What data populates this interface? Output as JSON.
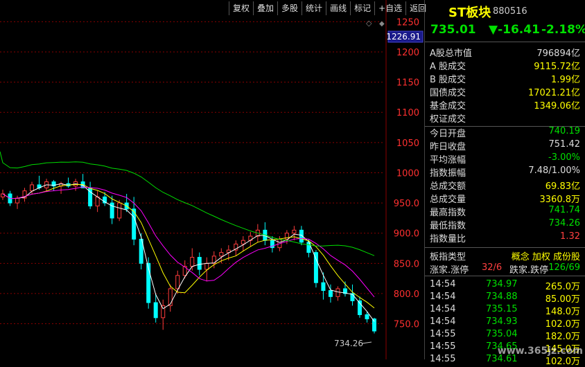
{
  "toolbar": [
    "复权",
    "叠加",
    "多股",
    "统计",
    "画线",
    "标记",
    "+自选",
    "返回"
  ],
  "header": {
    "name": "ST板块",
    "code": "880516",
    "price": "735.01",
    "change": "▼-16.41",
    "pct": "-2.18%"
  },
  "stats": [
    {
      "label": "A股总市值",
      "value": "796894亿",
      "color": "#dddddd"
    },
    {
      "label": "A 股成交",
      "value": "9115.72亿",
      "color": "#ffff00"
    },
    {
      "label": "B 股成交",
      "value": "1.99亿",
      "color": "#ffff00"
    },
    {
      "label": "国债成交",
      "value": "17021.21亿",
      "color": "#ffff00"
    },
    {
      "label": "基金成交",
      "value": "1349.06亿",
      "color": "#ffff00"
    },
    {
      "label": "权证成交",
      "value": "",
      "color": "#ffff00"
    },
    {
      "label": "今日开盘",
      "value": "740.19",
      "color": "#00e000"
    },
    {
      "label": "昨日收盘",
      "value": "751.42",
      "color": "#dddddd"
    },
    {
      "label": "平均涨幅",
      "value": "-3.00%",
      "color": "#00e000"
    },
    {
      "label": "指数振幅",
      "value": "7.48/1.00%",
      "color": "#dddddd"
    },
    {
      "label": "总成交额",
      "value": "69.83亿",
      "color": "#ffff00"
    },
    {
      "label": "总成交量",
      "value": "3360.8万",
      "color": "#ffff00"
    },
    {
      "label": "最高指数",
      "value": "741.74",
      "color": "#00e000"
    },
    {
      "label": "最低指数",
      "value": "734.26",
      "color": "#00e000"
    },
    {
      "label": "指数量比",
      "value": "1.32",
      "color": "#ff4040"
    }
  ],
  "board": {
    "label": "板指类型",
    "tags": "概念 加权 成份股"
  },
  "breadth": {
    "a_label": "涨家.涨停",
    "a_val": "32/6",
    "b_label": "跌家.跌停",
    "b_val": "126/69"
  },
  "ticks": [
    [
      "14:54",
      "734.97",
      "265.0万"
    ],
    [
      "14:54",
      "734.88",
      "85.00万"
    ],
    [
      "14:54",
      "735.15",
      "148.0万"
    ],
    [
      "14:54",
      "734.93",
      "102.0万"
    ],
    [
      "14:55",
      "735.04",
      "182.0万"
    ],
    [
      "14:55",
      "734.65",
      "145.0万"
    ],
    [
      "14:55",
      "734.61",
      "102.0万"
    ]
  ],
  "axis": {
    "labels": [
      "1250",
      "1200",
      "1150",
      "1100",
      "1050",
      "1000",
      "950.0",
      "900.0",
      "850.0",
      "800.0",
      "750.0"
    ],
    "current": "1226.91",
    "min_label": "734.26"
  },
  "watermark": "www.365jz.com",
  "chart_data": {
    "type": "candlestick",
    "ylim": [
      730,
      1255
    ],
    "ohlc": [
      [
        960,
        972,
        955,
        965
      ],
      [
        965,
        970,
        945,
        950
      ],
      [
        950,
        962,
        940,
        958
      ],
      [
        958,
        975,
        952,
        970
      ],
      [
        970,
        985,
        965,
        980
      ],
      [
        980,
        995,
        972,
        975
      ],
      [
        975,
        990,
        968,
        985
      ],
      [
        985,
        988,
        970,
        978
      ],
      [
        978,
        985,
        965,
        982
      ],
      [
        982,
        992,
        975,
        978
      ],
      [
        978,
        990,
        970,
        985
      ],
      [
        985,
        998,
        978,
        975
      ],
      [
        975,
        985,
        940,
        945
      ],
      [
        945,
        970,
        935,
        960
      ],
      [
        960,
        968,
        945,
        950
      ],
      [
        950,
        962,
        915,
        925
      ],
      [
        925,
        955,
        920,
        950
      ],
      [
        950,
        965,
        935,
        940
      ],
      [
        940,
        960,
        880,
        890
      ],
      [
        890,
        900,
        840,
        850
      ],
      [
        850,
        860,
        775,
        785
      ],
      [
        785,
        800,
        752,
        760
      ],
      [
        760,
        790,
        740,
        780
      ],
      [
        780,
        815,
        770,
        808
      ],
      [
        808,
        838,
        800,
        830
      ],
      [
        830,
        855,
        825,
        845
      ],
      [
        845,
        875,
        838,
        860
      ],
      [
        860,
        868,
        830,
        840
      ],
      [
        840,
        860,
        820,
        850
      ],
      [
        850,
        870,
        842,
        862
      ],
      [
        862,
        875,
        850,
        868
      ],
      [
        868,
        880,
        855,
        872
      ],
      [
        872,
        888,
        862,
        882
      ],
      [
        882,
        895,
        870,
        888
      ],
      [
        888,
        902,
        878,
        895
      ],
      [
        895,
        915,
        885,
        905
      ],
      [
        905,
        918,
        880,
        888
      ],
      [
        888,
        895,
        868,
        876
      ],
      [
        876,
        895,
        870,
        890
      ],
      [
        890,
        905,
        882,
        900
      ],
      [
        900,
        912,
        888,
        905
      ],
      [
        905,
        912,
        880,
        885
      ],
      [
        885,
        890,
        860,
        868
      ],
      [
        868,
        872,
        810,
        818
      ],
      [
        818,
        835,
        790,
        805
      ],
      [
        805,
        815,
        785,
        795
      ],
      [
        795,
        812,
        788,
        808
      ],
      [
        808,
        820,
        795,
        800
      ],
      [
        800,
        815,
        780,
        788
      ],
      [
        788,
        795,
        760,
        765
      ],
      [
        765,
        770,
        752,
        758
      ],
      [
        758,
        760,
        734,
        738
      ]
    ],
    "ma": [
      {
        "name": "MA5",
        "color": "#ffffff"
      },
      {
        "name": "MA10",
        "color": "#ffff00"
      },
      {
        "name": "MA20",
        "color": "#ff00ff"
      },
      {
        "name": "MA60",
        "color": "#00dd00"
      }
    ]
  }
}
